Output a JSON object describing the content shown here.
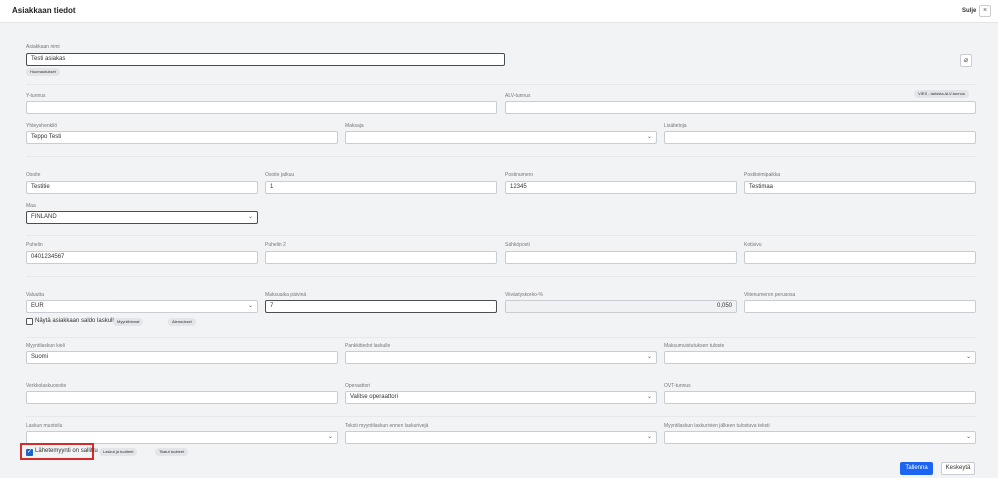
{
  "header": {
    "title": "Asiakkaan tiedot",
    "close_label": "Sulje",
    "close_icon": "×"
  },
  "customer": {
    "name_label": "Asiakkaan nimi",
    "name_value": "Testi asiakas",
    "notes_tag": "Huomautukset",
    "attach_icon": "⌀"
  },
  "ids": {
    "ytunnus_label": "Y-tunnus",
    "ytunnus_value": "",
    "alv_label": "ALV-tunnus",
    "alv_value": "",
    "vies_button": "VIES - tarkista ALV-tunnus"
  },
  "contact": {
    "person_label": "Yhteyshenkilö",
    "person_value": "Teppo Testi",
    "payer_label": "Maksaja",
    "payer_value": "",
    "extra_label": "Lisätietoja",
    "extra_value": ""
  },
  "address": {
    "street_label": "Osoite",
    "street_value": "Testitie",
    "street2_label": "Osoite jatkuu",
    "street2_value": "1",
    "zip_label": "Postinumero",
    "zip_value": "12345",
    "city_label": "Postitoimipaikka",
    "city_value": "Testimaa",
    "country_label": "Maa",
    "country_value": "FINLAND"
  },
  "phones": {
    "phone_label": "Puhelin",
    "phone_value": "0401234567",
    "phone2_label": "Puhelin 2",
    "phone2_value": "",
    "email_label": "Sähköposti",
    "email_value": "",
    "home_label": "Kotisivu",
    "home_value": ""
  },
  "payment": {
    "currency_label": "Valuutta",
    "currency_value": "EUR",
    "terms_label": "Maksuaika päivinä",
    "terms_value": "7",
    "interest_label": "Viivästyskorko-%",
    "interest_value": "0,050",
    "ref_label": "Viitenumeron perusosa",
    "ref_value": "",
    "show_balance_label": "Näytä asiakkaan saldo laskulla",
    "show_balance_checked": false,
    "sales_prices_tag": "Myyntihinnat",
    "discounts_tag": "Alennukset"
  },
  "invoicing": {
    "language_label": "Myyntilaskun kieli",
    "language_value": "Suomi",
    "bank_label": "Pankkitiedot laskulle",
    "bank_value": "",
    "reminder_label": "Maksumuistutuksen tuloste",
    "reminder_value": "",
    "einvoice_label": "Verkkolaskuosoite",
    "einvoice_value": "",
    "operator_label": "Operaattori",
    "operator_value": "Valitse operaattori",
    "ovt_label": "OVT-tunnus",
    "ovt_value": "",
    "format_label": "Laskun muotoilu",
    "format_value": "",
    "text_before_label": "Teksti myyntilaskun ennen laskurivejä",
    "text_before_value": "",
    "text_after_label": "Myyntilaskun laskurivien jälkeen tulostuva teksti",
    "text_after_value": "",
    "delivery_sale_label": "Lähetemyynti on sallittu",
    "delivery_sale_checked": true,
    "invoices_tag": "Laskut ja tuotteet",
    "orders_tag": "Tilatut tuotteet"
  },
  "footer": {
    "save_label": "Tallenna",
    "cancel_label": "Keskeytä"
  }
}
